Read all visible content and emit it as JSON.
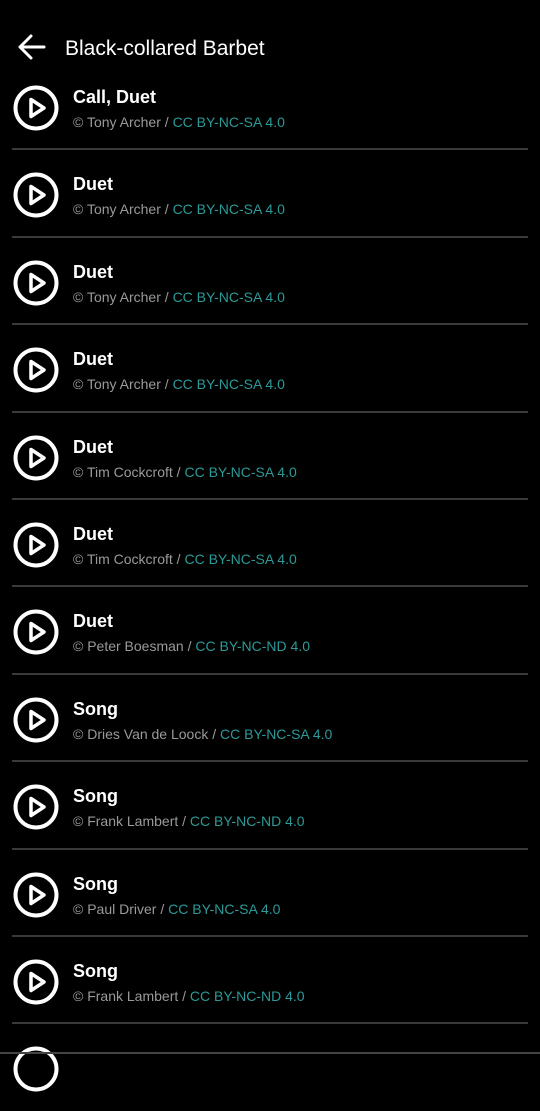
{
  "header": {
    "title": "Black-collared Barbet"
  },
  "recordings": [
    {
      "type": "Call, Duet",
      "author": "© Tony Archer",
      "license": "CC BY-NC-SA 4.0"
    },
    {
      "type": "Duet",
      "author": "© Tony Archer",
      "license": "CC BY-NC-SA 4.0"
    },
    {
      "type": "Duet",
      "author": "© Tony Archer",
      "license": "CC BY-NC-SA 4.0"
    },
    {
      "type": "Duet",
      "author": "© Tony Archer",
      "license": "CC BY-NC-SA 4.0"
    },
    {
      "type": "Duet",
      "author": "© Tim Cockcroft",
      "license": "CC BY-NC-SA 4.0"
    },
    {
      "type": "Duet",
      "author": "© Tim Cockcroft",
      "license": "CC BY-NC-SA 4.0"
    },
    {
      "type": "Duet",
      "author": "© Peter Boesman",
      "license": "CC BY-NC-ND 4.0"
    },
    {
      "type": "Song",
      "author": "© Dries Van de Loock",
      "license": "CC BY-NC-SA 4.0"
    },
    {
      "type": "Song",
      "author": "© Frank Lambert",
      "license": "CC BY-NC-ND 4.0"
    },
    {
      "type": "Song",
      "author": "© Paul Driver",
      "license": "CC BY-NC-SA 4.0"
    },
    {
      "type": "Song",
      "author": "© Frank Lambert",
      "license": "CC BY-NC-ND 4.0"
    }
  ],
  "separator": " / "
}
